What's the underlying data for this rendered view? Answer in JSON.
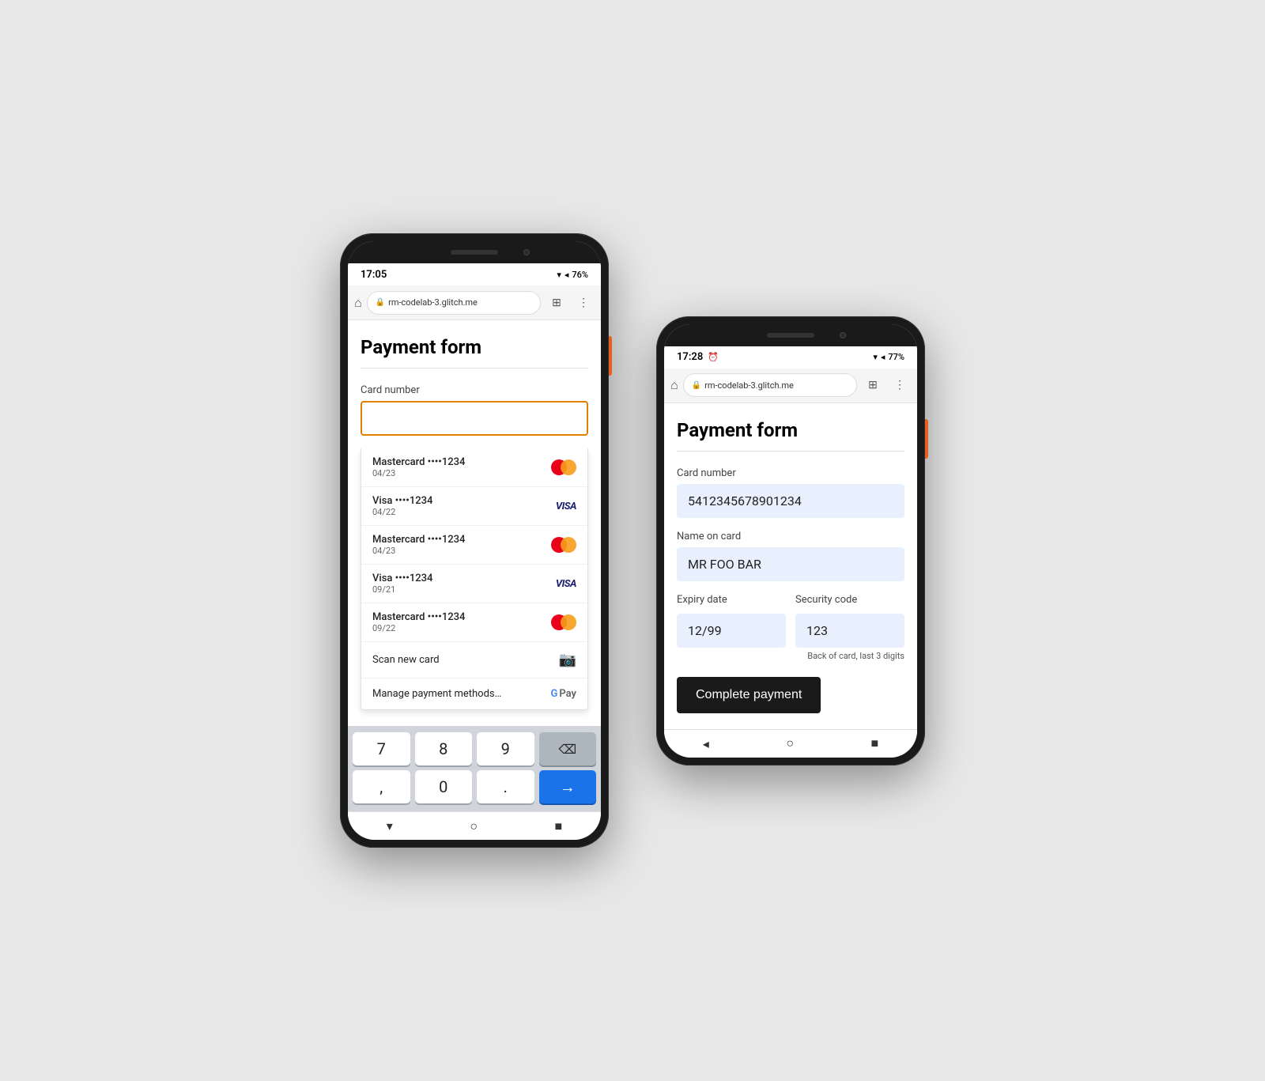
{
  "phones": {
    "left": {
      "status": {
        "time": "17:05",
        "battery": "76%",
        "icons": "▾◂🔋"
      },
      "browser": {
        "url": "rm-codelab-3.glitch.me"
      },
      "page": {
        "title": "Payment form",
        "card_label": "Card number",
        "card_placeholder": "",
        "saved_cards": [
          {
            "brand": "Mastercard",
            "dots": "••••1234",
            "expiry": "04/23",
            "type": "mastercard"
          },
          {
            "brand": "Visa",
            "dots": "••••1234",
            "expiry": "04/22",
            "type": "visa"
          },
          {
            "brand": "Mastercard",
            "dots": "••••1234",
            "expiry": "04/23",
            "type": "mastercard"
          },
          {
            "brand": "Visa",
            "dots": "••••1234",
            "expiry": "09/21",
            "type": "visa"
          },
          {
            "brand": "Mastercard",
            "dots": "••••1234",
            "expiry": "09/22",
            "type": "mastercard"
          }
        ],
        "scan_label": "Scan new card",
        "manage_label": "Manage payment methods…"
      },
      "keyboard": {
        "rows": [
          [
            "7",
            "8",
            "9",
            "⌫"
          ],
          [
            ",",
            "0",
            ".",
            "→"
          ]
        ]
      }
    },
    "right": {
      "status": {
        "time": "17:28",
        "battery": "77%"
      },
      "browser": {
        "url": "rm-codelab-3.glitch.me"
      },
      "page": {
        "title": "Payment form",
        "card_label": "Card number",
        "card_value": "5412345678901234",
        "name_label": "Name on card",
        "name_value": "MR FOO BAR",
        "expiry_label": "Expiry date",
        "expiry_value": "12/99",
        "security_label": "Security code",
        "security_value": "123",
        "security_hint": "Back of card, last 3 digits",
        "submit_label": "Complete payment"
      }
    }
  }
}
